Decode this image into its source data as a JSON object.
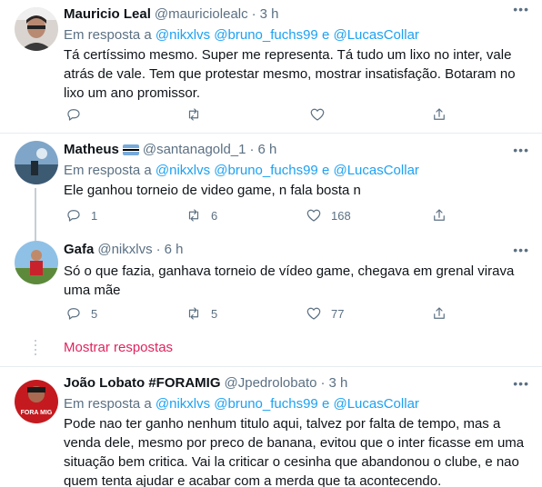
{
  "tweets": [
    {
      "name": "Mauricio Leal",
      "handle": "@mauriciolealc",
      "time": "3 h",
      "reply_prefix": "Em resposta a",
      "mentions": [
        "@nikxlvs",
        "@bruno_fuchs99",
        "@LucasCollar"
      ],
      "conj": "e",
      "text": "Tá certíssimo mesmo. Super me representa. Tá tudo um lixo no inter, vale atrás de vale. Tem que protestar mesmo, mostrar insatisfação. Botaram no lixo um ano promissor.",
      "replies": "",
      "retweets": "",
      "likes": ""
    },
    {
      "name": "Matheus",
      "handle": "@santanagold_1",
      "time": "6 h",
      "has_flag": true,
      "reply_prefix": "Em resposta a",
      "mentions": [
        "@nikxlvs",
        "@bruno_fuchs99",
        "@LucasCollar"
      ],
      "conj": "e",
      "text": "Ele ganhou torneio de video game, n fala bosta n",
      "replies": "1",
      "retweets": "6",
      "likes": "168"
    },
    {
      "name": "Gafa",
      "handle": "@nikxlvs",
      "time": "6 h",
      "text": "Só o que fazia, ganhava torneio de vídeo game, chegava em grenal virava uma mãe",
      "replies": "5",
      "retweets": "5",
      "likes": "77"
    },
    {
      "name": "João Lobato #FORAMIG",
      "handle": "@Jpedrolobato",
      "time": "3 h",
      "reply_prefix": "Em resposta a",
      "mentions": [
        "@nikxlvs",
        "@bruno_fuchs99",
        "@LucasCollar"
      ],
      "conj": "e",
      "text": "Pode nao ter ganho nenhum titulo aqui, talvez por falta de tempo, mas a venda dele, mesmo por preco de banana, evitou que o inter ficasse em uma situação bem critica. Vai la criticar o cesinha que abandonou o clube, e nao quem tenta ajudar e acabar com a merda que ta acontecendo.",
      "avatar_text": "FORA MIG"
    }
  ],
  "show_more": "Mostrar respostas",
  "separator": "·",
  "more_glyph": "•••",
  "colors": {
    "link": "#1da1f2",
    "muted": "#5b7083",
    "show_more": "#e0245e",
    "divider": "#e6ecf0"
  },
  "icons": [
    "reply-icon",
    "retweet-icon",
    "like-icon",
    "share-icon",
    "more-icon"
  ]
}
